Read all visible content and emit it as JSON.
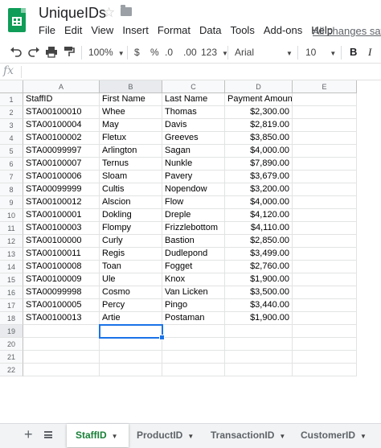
{
  "header": {
    "title": "UniqueIDs",
    "star_icon": "star-outline-icon",
    "folder_icon": "folder-icon",
    "menu": [
      "File",
      "Edit",
      "View",
      "Insert",
      "Format",
      "Data",
      "Tools",
      "Add-ons",
      "Help"
    ],
    "save_status": "All changes saved"
  },
  "toolbar": {
    "zoom": "100%",
    "currency": "$",
    "percent": "%",
    "decrease_decimal": ".0",
    "increase_decimal": ".00",
    "more_formats": "123",
    "font": "Arial",
    "font_size": "10",
    "bold": "B",
    "italic": "I"
  },
  "formula_bar": {
    "fx": "fx",
    "value": ""
  },
  "grid": {
    "columns": [
      "A",
      "B",
      "C",
      "D",
      "E"
    ],
    "rows": [
      [
        "StaffID",
        "First Name",
        "Last Name",
        "Payment Amount"
      ],
      [
        "STA00100010",
        "Whee",
        "Thomas",
        "$2,300.00"
      ],
      [
        "STA00100004",
        "May",
        "Davis",
        "$2,819.00"
      ],
      [
        "STA00100002",
        "Fletux",
        "Greeves",
        "$3,850.00"
      ],
      [
        "STA00099997",
        "Arlington",
        "Sagan",
        "$4,000.00"
      ],
      [
        "STA00100007",
        "Ternus",
        "Nunkle",
        "$7,890.00"
      ],
      [
        "STA00100006",
        "Sloam",
        "Pavery",
        "$3,679.00"
      ],
      [
        "STA00099999",
        "Cultis",
        "Nopendow",
        "$3,200.00"
      ],
      [
        "STA00100012",
        "Alscion",
        "Flow",
        "$4,000.00"
      ],
      [
        "STA00100001",
        "Dokling",
        "Dreple",
        "$4,120.00"
      ],
      [
        "STA00100003",
        "Flompy",
        "Frizzlebottom",
        "$4,110.00"
      ],
      [
        "STA00100000",
        "Curly",
        "Bastion",
        "$2,850.00"
      ],
      [
        "STA00100011",
        "Regis",
        "Dudlepond",
        "$3,499.00"
      ],
      [
        "STA00100008",
        "Toan",
        "Fogget",
        "$2,760.00"
      ],
      [
        "STA00100009",
        "Ule",
        "Knox",
        "$1,900.00"
      ],
      [
        "STA00099998",
        "Cosmo",
        "Van Licken",
        "$3,500.00"
      ],
      [
        "STA00100005",
        "Percy",
        "Pingo",
        "$3,440.00"
      ],
      [
        "STA00100013",
        "Artie",
        "Postaman",
        "$1,900.00"
      ]
    ],
    "row_count": 22,
    "selected_cell": "B19",
    "selection_color": "#1a73e8"
  },
  "sheets": {
    "add_icon": "+",
    "list_icon": "sheet-list-icon",
    "tabs": [
      "StaffID",
      "ProductID",
      "TransactionID",
      "CustomerID"
    ],
    "active": "StaffID",
    "active_color": "#188038"
  }
}
